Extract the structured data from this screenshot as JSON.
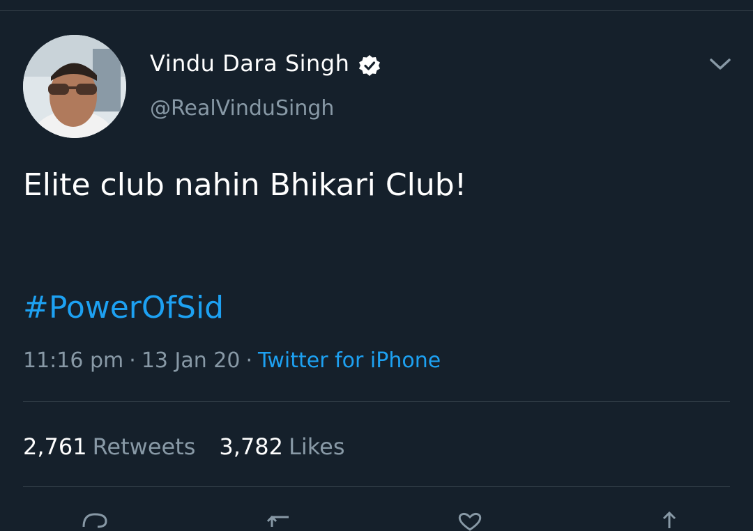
{
  "tweet": {
    "display_name": "Vindu Dara Singh",
    "handle": "@RealVinduSingh",
    "text": "Elite club nahin Bhikari Club!",
    "hashtag": "#PowerOfSid",
    "time": "11:16 pm",
    "date": "13 Jan 20",
    "source": "Twitter for iPhone",
    "separator": "·"
  },
  "stats": {
    "retweets_count": "2,761",
    "retweets_label": "Retweets",
    "likes_count": "3,782",
    "likes_label": "Likes"
  },
  "icons": {
    "verified": "verified-badge-icon",
    "more": "chevron-down-icon",
    "actions": [
      "reply-icon",
      "retweet-icon",
      "like-icon",
      "share-icon"
    ]
  },
  "colors": {
    "background": "#15202b",
    "text": "#ffffff",
    "secondary": "#8899a6",
    "accent": "#1da1f2",
    "divider": "#38444d"
  }
}
